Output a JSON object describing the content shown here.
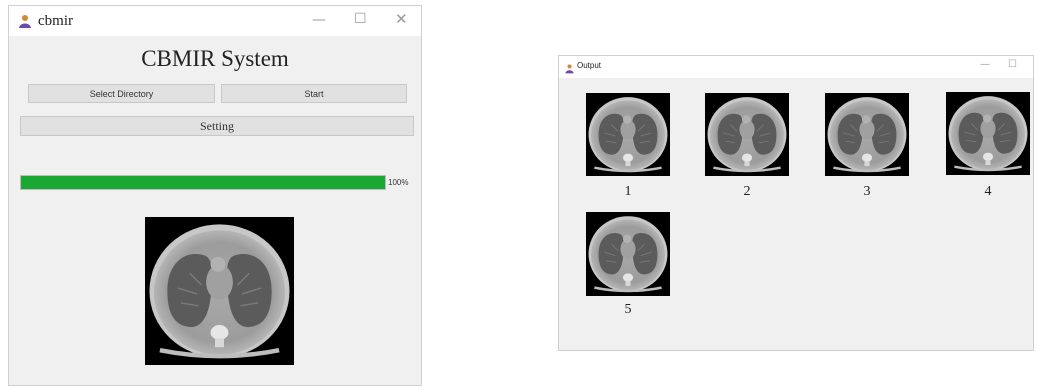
{
  "main_window": {
    "title": "cbmir",
    "heading": "CBMIR System",
    "select_directory_label": "Select Directory",
    "start_label": "Start",
    "setting_label": "Setting",
    "progress": {
      "value": 100,
      "text": "100%"
    },
    "colors": {
      "progress": "#19a832"
    }
  },
  "output_window": {
    "title": "Output",
    "results": [
      {
        "label": "1"
      },
      {
        "label": "2"
      },
      {
        "label": "3"
      },
      {
        "label": "4"
      },
      {
        "label": "5"
      }
    ]
  },
  "icons": {
    "app": "person-icon",
    "minimize": "minimize-icon",
    "maximize": "maximize-icon",
    "close": "close-icon"
  }
}
